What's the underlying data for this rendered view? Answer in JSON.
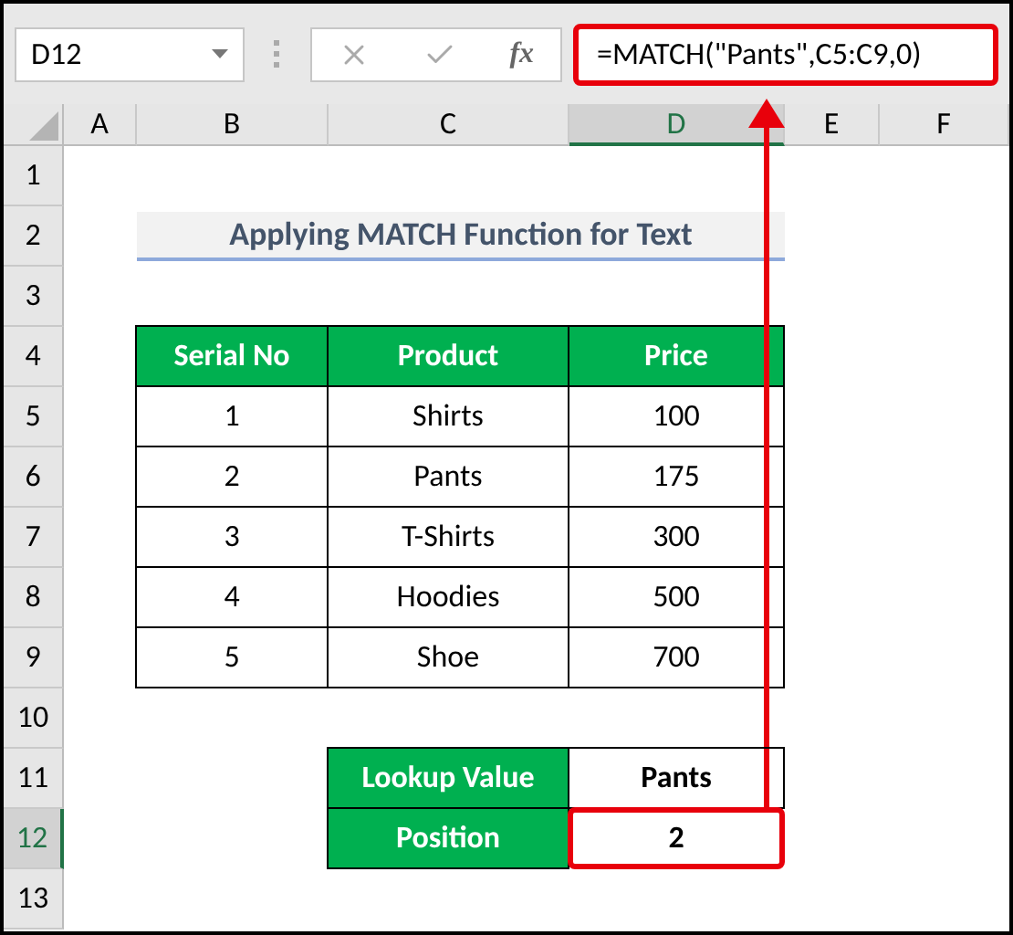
{
  "name_box": {
    "value": "D12"
  },
  "formula_bar": {
    "function_label": "fx",
    "formula": "=MATCH(\"Pants\",C5:C9,0)",
    "highlighted": true
  },
  "columns": [
    {
      "label": "A",
      "selected": false
    },
    {
      "label": "B",
      "selected": false
    },
    {
      "label": "C",
      "selected": false
    },
    {
      "label": "D",
      "selected": true
    },
    {
      "label": "E",
      "selected": false
    },
    {
      "label": "F",
      "selected": false
    }
  ],
  "rows": [
    {
      "label": "1",
      "selected": false
    },
    {
      "label": "2",
      "selected": false
    },
    {
      "label": "3",
      "selected": false
    },
    {
      "label": "4",
      "selected": false
    },
    {
      "label": "5",
      "selected": false
    },
    {
      "label": "6",
      "selected": false
    },
    {
      "label": "7",
      "selected": false
    },
    {
      "label": "8",
      "selected": false
    },
    {
      "label": "9",
      "selected": false
    },
    {
      "label": "10",
      "selected": false
    },
    {
      "label": "11",
      "selected": false
    },
    {
      "label": "12",
      "selected": true
    },
    {
      "label": "13",
      "selected": false
    }
  ],
  "title": "Applying MATCH Function for Text",
  "table": {
    "columns": [
      "Serial No",
      "Product",
      "Price"
    ],
    "rows": [
      [
        "1",
        "Shirts",
        "100"
      ],
      [
        "2",
        "Pants",
        "175"
      ],
      [
        "3",
        "T-Shirts",
        "300"
      ],
      [
        "4",
        "Hoodies",
        "500"
      ],
      [
        "5",
        "Shoe",
        "700"
      ]
    ]
  },
  "lookup": [
    {
      "label": "Lookup Value",
      "value": "Pants",
      "highlighted": false
    },
    {
      "label": "Position",
      "value": "2",
      "highlighted": true
    }
  ]
}
